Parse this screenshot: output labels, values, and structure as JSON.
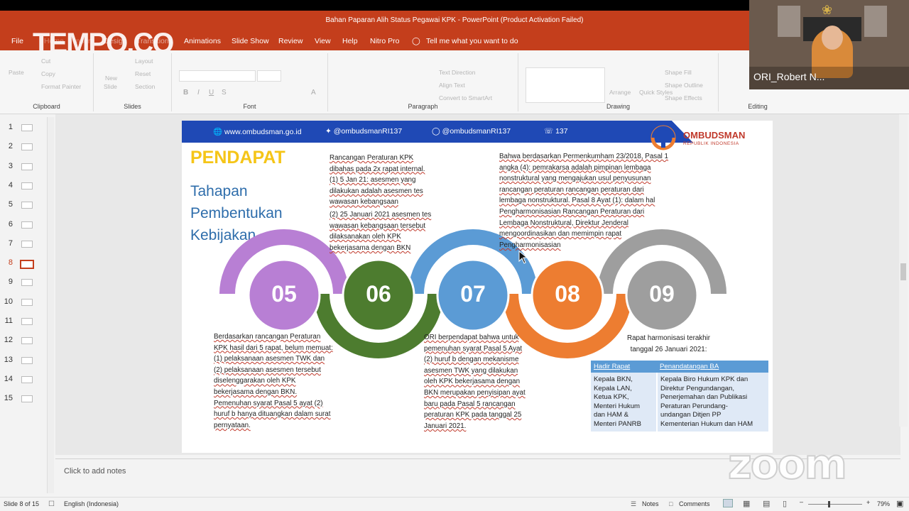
{
  "window": {
    "title": "Bahan Paparan Alih Status Pegawai KPK  -  PowerPoint (Product Activation Failed)"
  },
  "watermark": {
    "tempo": "TEMPO.CO",
    "zoom": "zoom"
  },
  "webcam": {
    "participant_name": "ORI_Robert N..."
  },
  "menu": {
    "file": "File",
    "home": "Home",
    "insert": "Insert",
    "design": "Design",
    "transitions": "Transitions",
    "animations": "Animations",
    "slideshow": "Slide Show",
    "review": "Review",
    "view": "View",
    "help": "Help",
    "nitro": "Nitro Pro",
    "tell": "Tell me what you want to do"
  },
  "ribbon": {
    "clipboard": "Clipboard",
    "slides": "Slides",
    "font": "Font",
    "paragraph": "Paragraph",
    "drawing": "Drawing",
    "editing": "Editing",
    "ghost": {
      "paste": "Paste",
      "cut": "Cut",
      "copy": "Copy",
      "format_painter": "Format Painter",
      "new": "New",
      "slide": "Slide",
      "layout": "Layout",
      "reset": "Reset",
      "section": "Section",
      "text_direction": "Text Direction",
      "align_text": "Align Text",
      "convert_smartart": "Convert to SmartArt",
      "arrange": "Arrange",
      "quick_styles": "Quick Styles",
      "shape_fill": "Shape Fill",
      "shape_outline": "Shape Outline",
      "shape_effects": "Shape Effects"
    }
  },
  "thumbnails": [
    "1",
    "2",
    "3",
    "4",
    "5",
    "6",
    "7",
    "8",
    "9",
    "10",
    "11",
    "12",
    "13",
    "14",
    "15"
  ],
  "active_slide_index": 8,
  "slide": {
    "banner": {
      "website": "www.ombudsman.go.id",
      "twitter": "@ombudsmanRI137",
      "instagram": "@ombudsmanRI137",
      "phone": "137"
    },
    "logo": {
      "name": "OMBUDSMAN",
      "sub": "REPUBLIK INDONESIA"
    },
    "heading": "PENDAPAT",
    "subheading": [
      "Tahapan",
      "Pembentukan",
      "Kebijakan"
    ],
    "circles": [
      {
        "label": "05",
        "color": "#b87fd4"
      },
      {
        "label": "06",
        "color": "#4d7c2f"
      },
      {
        "label": "07",
        "color": "#5b9bd5"
      },
      {
        "label": "08",
        "color": "#ed7d31"
      },
      {
        "label": "09",
        "color": "#9e9e9e"
      }
    ],
    "text_06": [
      "Rancangan Peraturan KPK",
      "dibahas pada 2x rapat internal.",
      "(1) 5 Jan 21: asesmen yang",
      "dilakukan adalah asesmen tes",
      "wawasan kebangsaan",
      "(2) 25 Januari 2021  asesmen tes",
      "wawasan kebangsaan tersebut",
      "dilaksanakan oleh KPK",
      "bekerjasama dengan BKN"
    ],
    "text_08": [
      "Bahwa berdasarkan Permenkumham 23/2018, Pasal 1",
      "angka (4): pemrakarsa adalah pimpinan lembaga",
      "nonstruktural yang mengajukan usul penyusunan",
      "rancangan peraturan rancangan peraturan dari",
      "lembaga nonstruktural. Pasal 8 Ayat (1): dalam hal",
      "Pengharmonisasian Rancangan Peraturan dari",
      "Lembaga Nonstruktural, Direktur Jenderal",
      "mengoordinasikan dan memimpin rapat",
      "Pengharmonisasian"
    ],
    "text_05": [
      "Berdasarkan rancangan Peraturan",
      "KPK hasil dari 5 rapat, belum memuat:",
      "(1) pelaksanaan asesmen TWK dan",
      "(2) pelaksanaan asesmen tersebut",
      "diselenggarakan oleh KPK",
      "bekerjasama dengan BKN.",
      "Pemenuhan syarat Pasal 5 ayat (2)",
      "huruf b hanya dituangkan dalam surat",
      "pernyataan."
    ],
    "text_07": [
      "ORI berpendapat bahwa untuk",
      "pemenuhan syarat  Pasal 5 Ayat",
      "(2) huruf b dengan mekanisme",
      "asesmen TWK yang dilakukan",
      "oleh KPK bekerjasama dengan",
      "BKN merupakan penyisipan ayat",
      "baru pada Pasal 5 rancangan",
      "peraturan KPK pada tanggal 25",
      "Januari 2021."
    ],
    "text_09": [
      "Rapat harmonisasi terakhir",
      "tanggal 26 Januari 2021:"
    ],
    "table": {
      "headers": [
        "Hadir Rapat",
        "Penandatangan BA"
      ],
      "rows": [
        [
          "Kepala BKN,\nKepala LAN,\nKetua KPK,\nMenteri Hukum\ndan HAM &\nMenteri PANRB",
          "Kepala Biro Hukum KPK dan\nDirektur Pengundangan,\nPenerjemahan dan Publikasi\nPeraturan Perundang-\nundangan Ditjen PP\nKementerian Hukum dan HAM"
        ]
      ]
    }
  },
  "notes_placeholder": "Click to add notes",
  "status": {
    "slide": "Slide 8 of 15",
    "language": "English (Indonesia)",
    "notes": "Notes",
    "comments": "Comments",
    "zoom": "79%"
  }
}
